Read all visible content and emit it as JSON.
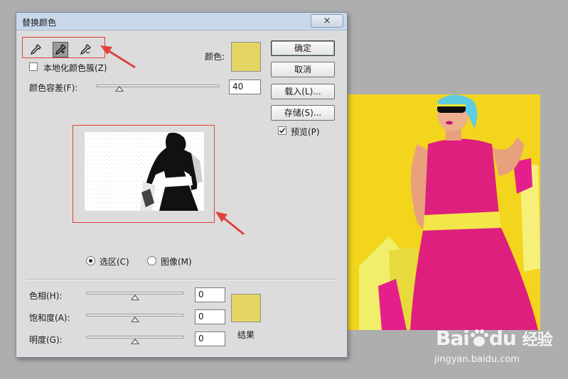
{
  "dialog": {
    "title": "替换颜色",
    "close_icon": "×",
    "color_label": "颜色:",
    "localized_label": "本地化颜色簇(Z)",
    "fuzziness_label": "颜色容差(F):",
    "fuzziness_value": "40",
    "selection_label": "选区(C)",
    "image_label": "图像(M)",
    "hue_label": "色相(H):",
    "hue_value": "0",
    "saturation_label": "饱和度(A):",
    "saturation_value": "0",
    "lightness_label": "明度(G):",
    "lightness_value": "0",
    "result_label": "结果",
    "swatch_color": "#e4d461",
    "result_color": "#e4d461",
    "fuzziness_slider": 0.19,
    "hue_slider": 0.5,
    "saturation_slider": 0.5,
    "lightness_slider": 0.5
  },
  "buttons": {
    "ok": "确定",
    "cancel": "取消",
    "load": "载入(L)...",
    "save": "存储(S)...",
    "preview": "预览(P)"
  },
  "tools": [
    "eyedropper-icon",
    "eyedropper-plus-icon",
    "eyedropper-minus-icon"
  ],
  "watermark": {
    "brand_a": "Bai",
    "brand_b": "du",
    "brand_cn": "经验",
    "url": "jingyan.baidu.com"
  },
  "annotation_color": "#e0413a"
}
